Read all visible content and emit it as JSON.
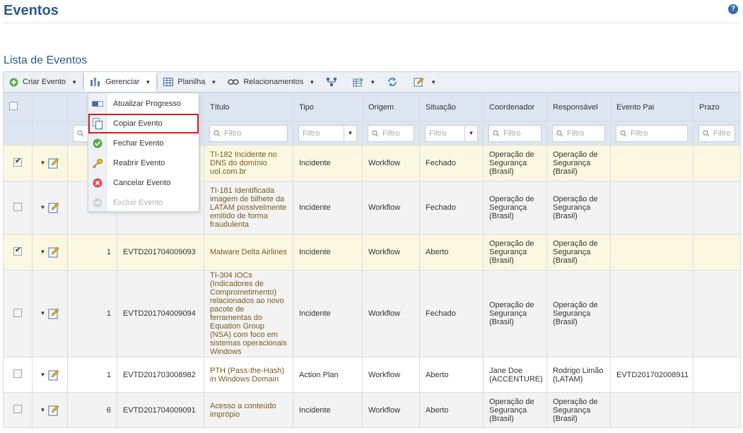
{
  "page": {
    "title": "Eventos",
    "help": "?"
  },
  "section": {
    "title": "Lista de Eventos"
  },
  "toolbar": {
    "create_label": "Criar Evento",
    "manage_label": "Gerenciar",
    "sheet_label": "Planilha",
    "relations_label": "Relacionamentos"
  },
  "menu": {
    "items": [
      {
        "label": "Atualizar Progresso",
        "icon": "progress-bar-icon"
      },
      {
        "label": "Copiar Evento",
        "icon": "copy-icon"
      },
      {
        "label": "Fechar Evento",
        "icon": "check-circle-icon"
      },
      {
        "label": "Reabrir Evento",
        "icon": "key-icon"
      },
      {
        "label": "Cancelar Evento",
        "icon": "cancel-circle-icon"
      },
      {
        "label": "Excluir Evento",
        "icon": "minus-circle-icon"
      }
    ]
  },
  "columns": {
    "title": "Título",
    "type": "Tipo",
    "origin": "Origem",
    "status": "Situação",
    "coordinator": "Coordenador",
    "responsible": "Responsável",
    "parent": "Evento Pai",
    "deadline": "Prazo"
  },
  "filters": {
    "placeholder": "Filtro"
  },
  "rows": [
    {
      "checked": true,
      "count": "",
      "id": "",
      "title": "TI-182 Incidente no DNS do domínio uol.com.br",
      "type": "Incidente",
      "origin": "Workflow",
      "status": "Fechado",
      "coordinator": "Operação de Segurança (Brasil)",
      "responsible": "Operação de Segurança (Brasil)",
      "parent": "",
      "deadline": ""
    },
    {
      "checked": false,
      "count": "",
      "id": "",
      "title": "TI-181 Identificada imagem de bilhete da LATAM possivelmente emitido de forma fraudulenta",
      "type": "Incidente",
      "origin": "Workflow",
      "status": "Fechado",
      "coordinator": "Operação de Segurança (Brasil)",
      "responsible": "Operação de Segurança (Brasil)",
      "parent": "",
      "deadline": ""
    },
    {
      "checked": true,
      "count": "1",
      "id": "EVTD201704009093",
      "title": "Malware Delta Airlines",
      "type": "Incidente",
      "origin": "Workflow",
      "status": "Aberto",
      "coordinator": "Operação de Segurança (Brasil)",
      "responsible": "Operação de Segurança (Brasil)",
      "parent": "",
      "deadline": ""
    },
    {
      "checked": false,
      "count": "1",
      "id": "EVTD201704009094",
      "title": "TI-304 IOCs (Indicadores de Comprometimento) relacionados ao novo pacote de ferramentas do Equation Group (NSA) com foco em sistemas operacionais Windows",
      "type": "Incidente",
      "origin": "Workflow",
      "status": "Fechado",
      "coordinator": "Operação de Segurança (Brasil)",
      "responsible": "Operação de Segurança (Brasil)",
      "parent": "",
      "deadline": ""
    },
    {
      "checked": false,
      "count": "1",
      "id": "EVTD201703008982",
      "title": "PTH (Pass-the-Hash) in Windows Domain",
      "type": "Action Plan",
      "origin": "Workflow",
      "status": "Aberto",
      "coordinator": "Jane Doe (ACCENTURE)",
      "responsible": "Rodrigo Limão (LATAM)",
      "parent": "EVTD201702008911",
      "deadline": ""
    },
    {
      "checked": false,
      "count": "6",
      "id": "EVTD201704009091",
      "title": "Acesso a conteúdo imprópio",
      "type": "Incidente",
      "origin": "Workflow",
      "status": "Aberto",
      "coordinator": "Operação de Segurança (Brasil)",
      "responsible": "Operação de Segurança (Brasil)",
      "parent": "",
      "deadline": ""
    }
  ],
  "colors": {
    "title_blue": "#2a5b8c",
    "selected_row": "#fbf8e1",
    "header_bg": "#dde6f1",
    "highlight": "#d71f1f"
  }
}
